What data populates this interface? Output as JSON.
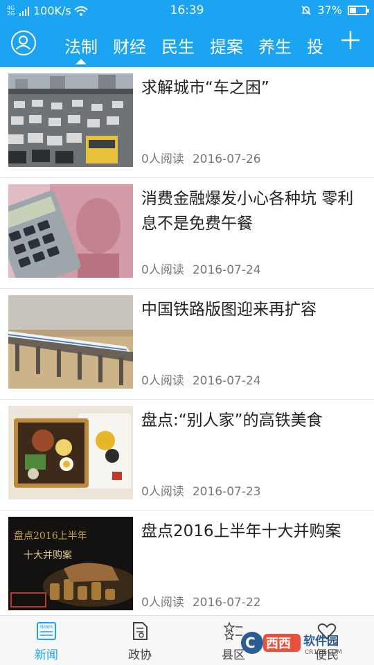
{
  "status_bar": {
    "network": "4G 2G",
    "speed": "100K/s",
    "time": "16:39",
    "battery": "37%"
  },
  "header": {
    "tabs": [
      {
        "label": "法制",
        "active": true
      },
      {
        "label": "财经"
      },
      {
        "label": "民生"
      },
      {
        "label": "提案"
      },
      {
        "label": "养生"
      },
      {
        "label": "投"
      }
    ],
    "add_icon": "plus-icon",
    "profile_icon": "user-icon"
  },
  "articles": [
    {
      "title": "求解城市“车之困”",
      "reads": "0人阅读",
      "date": "2016-07-26",
      "image": "traffic-jam-photo"
    },
    {
      "title": "消费金融爆发小心各种坑 零利息不是免费午餐",
      "reads": "0人阅读",
      "date": "2016-07-24",
      "image": "calculator-banknote-photo"
    },
    {
      "title": "中国铁路版图迎来再扩容",
      "reads": "0人阅读",
      "date": "2016-07-24",
      "image": "high-speed-train-photo"
    },
    {
      "title": "盘点:“别人家”的高铁美食",
      "reads": "0人阅读",
      "date": "2016-07-23",
      "image": "bento-box-photo"
    },
    {
      "title": "盘点2016上半年十大并购案",
      "reads": "0人阅读",
      "date": "2016-07-22",
      "image": "merger-coins-photo",
      "image_text": [
        "盘点2016上半年",
        "十大并购案"
      ]
    }
  ],
  "bottom_nav": [
    {
      "label": "新闻",
      "icon": "news-icon",
      "active": true
    },
    {
      "label": "政协",
      "icon": "document-icon"
    },
    {
      "label": "县区",
      "icon": "stars-icon"
    },
    {
      "label": "便民",
      "icon": "heart-icon"
    }
  ],
  "watermark": {
    "text": "西西软件园",
    "url_text": "CR173.COM"
  },
  "colors": {
    "accent": "#1aa4f2"
  }
}
